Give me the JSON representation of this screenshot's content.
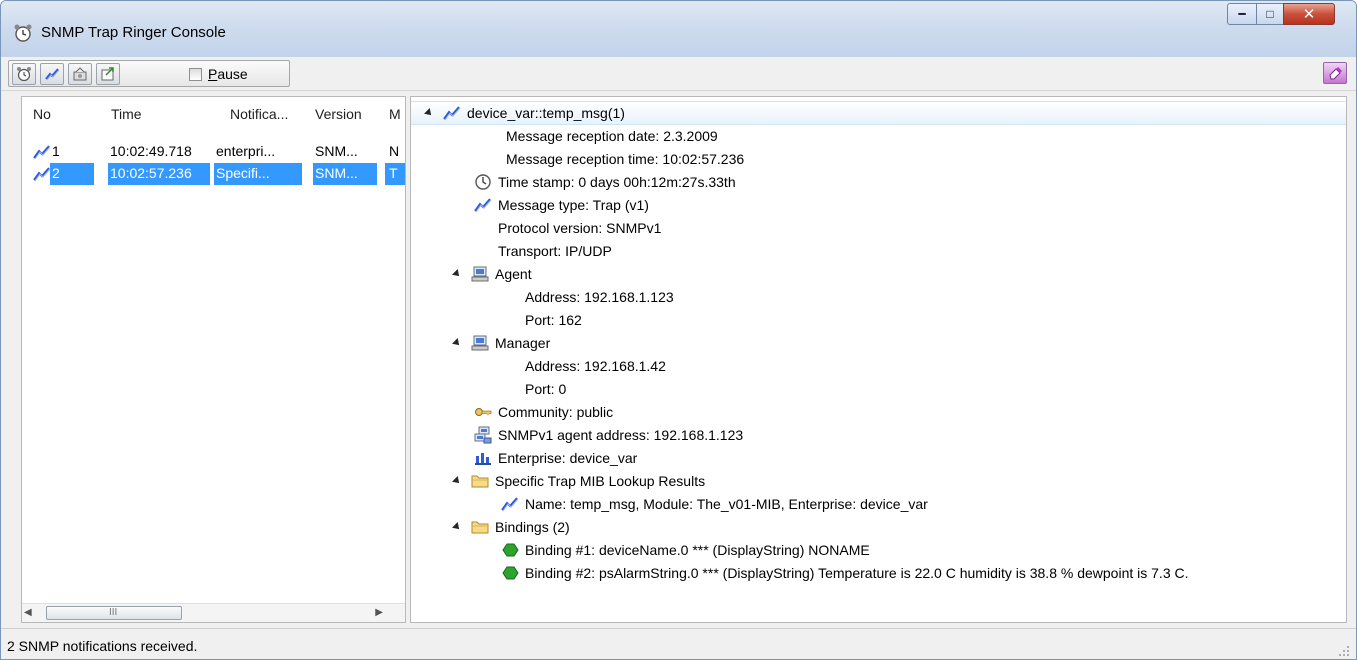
{
  "window": {
    "title": "SNMP Trap Ringer Console"
  },
  "toolbar": {
    "pause_label_pre": "",
    "pause_underlined": "P",
    "pause_label_post": "ause",
    "pause_checked": false
  },
  "list": {
    "columns": [
      "No",
      "Time",
      "Notifica...",
      "Version",
      "M"
    ],
    "rows": [
      {
        "no": "1",
        "time": "10:02:49.718",
        "notification": "enterpri...",
        "version": "SNM...",
        "m": "N",
        "selected": false
      },
      {
        "no": "2",
        "time": "10:02:57.236",
        "notification": "Specifi...",
        "version": "SNM...",
        "m": "T",
        "selected": true
      }
    ],
    "hscroll_grip": "III"
  },
  "tree": {
    "root": "device_var::temp_msg(1)",
    "reception_date": "Message reception date: 2.3.2009",
    "reception_time": "Message reception time: 10:02:57.236",
    "time_stamp": "Time stamp: 0 days 00h:12m:27s.33th",
    "message_type": "Message type: Trap (v1)",
    "protocol_version": "Protocol version: SNMPv1",
    "transport": "Transport: IP/UDP",
    "agent": "Agent",
    "agent_address": "Address: 192.168.1.123",
    "agent_port": "Port: 162",
    "manager": "Manager",
    "manager_address": "Address: 192.168.1.42",
    "manager_port": "Port: 0",
    "community": "Community: public",
    "agent_addr_v1": "SNMPv1 agent address: 192.168.1.123",
    "enterprise": "Enterprise: device_var",
    "specific_trap": "Specific Trap MIB Lookup Results",
    "lookup_name": "Name: temp_msg, Module: The_v01-MIB, Enterprise: device_var",
    "bindings": "Bindings (2)",
    "binding1": "Binding #1: deviceName.0 *** (DisplayString) NONAME",
    "binding2": "Binding #2: psAlarmString.0 *** (DisplayString) Temperature is 22.0 C humidity is 38.8 % dewpoint is 7.3 C."
  },
  "status": {
    "text": "2 SNMP notifications received."
  },
  "colors": {
    "selection": "#3399ff",
    "title_bg": "#cfdcee",
    "trap_icon": "#2f5bd8"
  }
}
